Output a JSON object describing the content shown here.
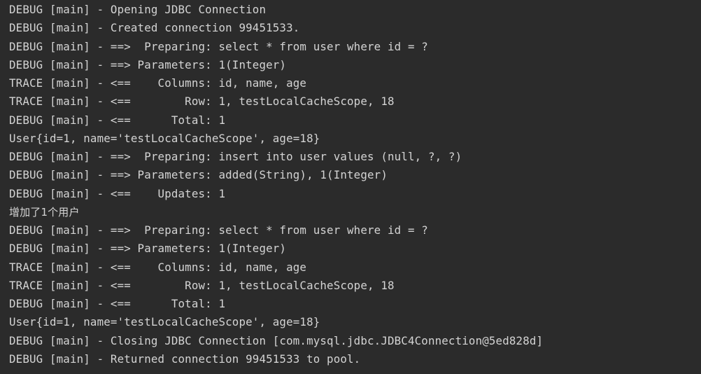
{
  "console": {
    "lines": [
      "DEBUG [main] - Opening JDBC Connection",
      "DEBUG [main] - Created connection 99451533.",
      "DEBUG [main] - ==>  Preparing: select * from user where id = ?",
      "DEBUG [main] - ==> Parameters: 1(Integer)",
      "TRACE [main] - <==    Columns: id, name, age",
      "TRACE [main] - <==        Row: 1, testLocalCacheScope, 18",
      "DEBUG [main] - <==      Total: 1",
      "User{id=1, name='testLocalCacheScope', age=18}",
      "DEBUG [main] - ==>  Preparing: insert into user values (null, ?, ?)",
      "DEBUG [main] - ==> Parameters: added(String), 1(Integer)",
      "DEBUG [main] - <==    Updates: 1",
      "增加了1个用户",
      "DEBUG [main] - ==>  Preparing: select * from user where id = ?",
      "DEBUG [main] - ==> Parameters: 1(Integer)",
      "TRACE [main] - <==    Columns: id, name, age",
      "TRACE [main] - <==        Row: 1, testLocalCacheScope, 18",
      "DEBUG [main] - <==      Total: 1",
      "User{id=1, name='testLocalCacheScope', age=18}",
      "DEBUG [main] - Closing JDBC Connection [com.mysql.jdbc.JDBC4Connection@5ed828d]",
      "DEBUG [main] - Returned connection 99451533 to pool."
    ]
  },
  "colors": {
    "background": "#2b2b2b",
    "text": "#d4d4d4"
  }
}
